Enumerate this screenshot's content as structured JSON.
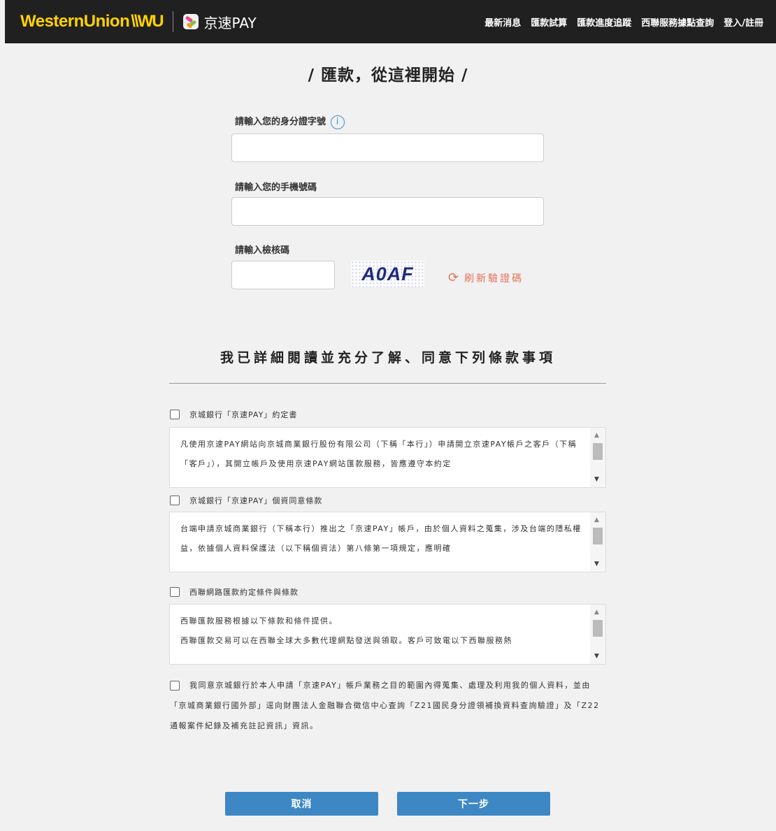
{
  "header": {
    "brand_wu": "WesternUnion",
    "brand_wu_mark": "\\\\WU",
    "brand_jk": "京速PAY",
    "nav": [
      "最新消息",
      "匯款試算",
      "匯款進度追蹤",
      "西聯服務據點查詢",
      "登入/註冊"
    ]
  },
  "page_title": "/ 匯款，從這裡開始 /",
  "form": {
    "id_label": "請輸入您的身分證字號",
    "id_info_icon": "i",
    "id_value": "",
    "phone_label": "請輸入您的手機號碼",
    "phone_value": "",
    "captcha_label": "請輸入檢核碼",
    "captcha_value": "",
    "captcha_image_text": "A0AF",
    "refresh_label": "刷新驗證碼",
    "refresh_icon": "refresh-icon"
  },
  "terms": {
    "heading": "我已詳細閱讀並充分了解、同意下列條款事項",
    "items": [
      {
        "label": "京城銀行「京速PAY」約定書",
        "text": "凡使用京速PAY網站向京城商業銀行股份有限公司（下稱「本行」）申請開立京速PAY帳戶之客戶（下稱「客戶」），其開立帳戶及使用京速PAY網站匯款服務，皆應遵守本約定"
      },
      {
        "label": "京城銀行「京速PAY」個資同意條款",
        "text": "台端申請京城商業銀行（下稱本行）推出之「京速PAY」帳戶，由於個人資料之蒐集，涉及台端的隱私權益，依據個人資料保護法（以下稱個資法）第八條第一項規定，應明確"
      },
      {
        "label": "西聯網路匯款約定條件與條款",
        "text_lines": [
          "西聯匯款服務根據以下條款和條件提供。",
          "西聯匯款交易可以在西聯全球大多數代理網點發送與領取。客戶可致電以下西聯服務熱"
        ]
      }
    ],
    "consent": "我同意京城銀行於本人申請「京速PAY」帳戶業務之目的範圍內得蒐集、處理及利用我的個人資料，並由「京城商業銀行國外部」逕向財團法人金融聯合徵信中心查詢「Z21國民身分證領補換資料查詢驗證」及「Z22通報案件紀錄及補充註記資訊」資訊。"
  },
  "buttons": {
    "cancel": "取消",
    "next": "下一步"
  },
  "colors": {
    "header_bg": "#202020",
    "brand_yellow": "#ffd200",
    "button_blue": "#3d87c4",
    "refresh_orange": "#e8705a",
    "info_blue": "#3b8fd6"
  }
}
